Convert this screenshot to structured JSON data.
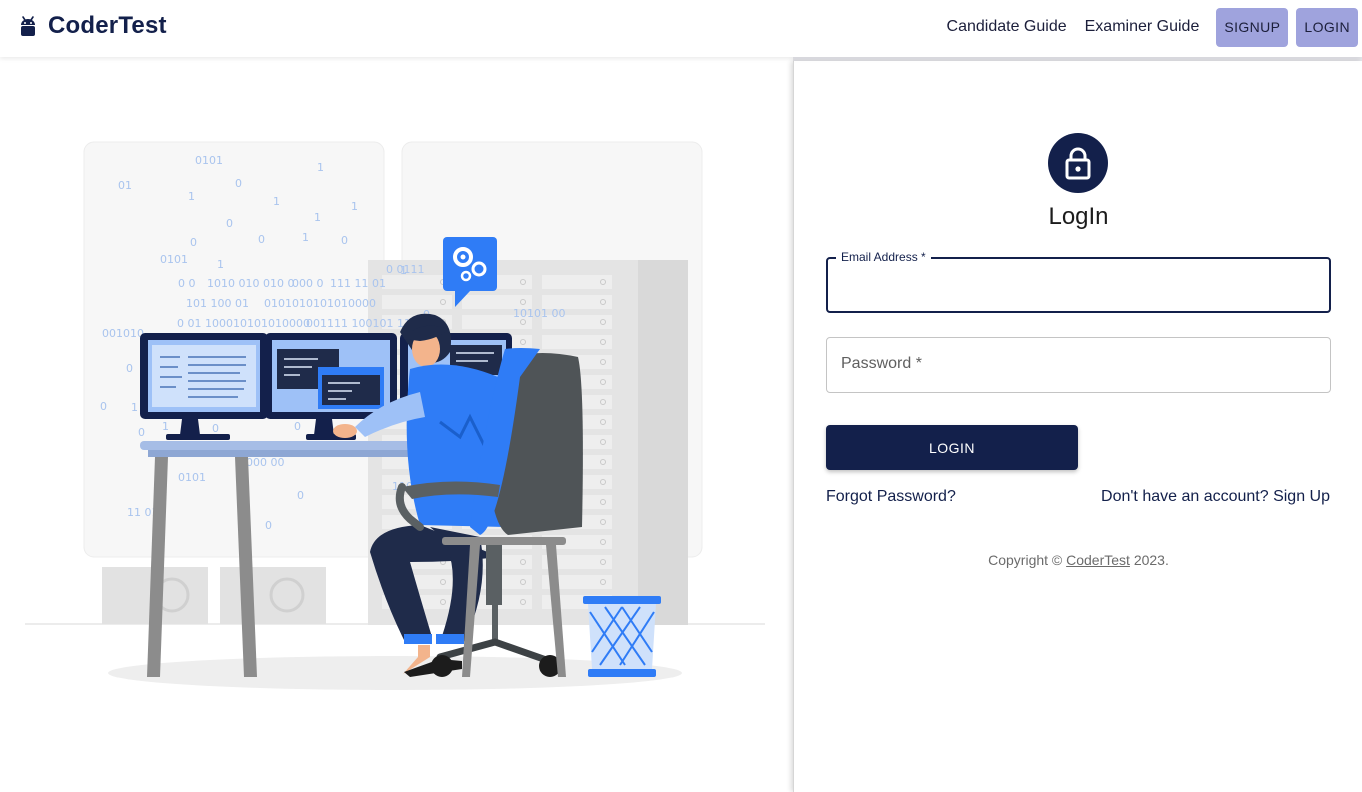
{
  "brand": {
    "name": "CoderTest",
    "icon": "android-icon"
  },
  "nav": {
    "candidate_guide": "Candidate Guide",
    "examiner_guide": "Examiner Guide",
    "signup": "SIGNUP",
    "login": "LOGIN"
  },
  "illustration": {
    "icon": "developer-at-desk-illustration",
    "binary_digits": [
      "0101",
      "1",
      "01",
      "1",
      "0",
      "1",
      "1",
      "0",
      "1",
      "0",
      "0",
      "1",
      "0",
      "0101",
      "1",
      "0 0",
      "1010 010 010 0",
      "000 0",
      "111 11 01",
      "101 100 01",
      "0101010101010000",
      "0 01 100010101010000",
      "001111 100101 110",
      "001010",
      "0",
      "1",
      "0",
      "0",
      "0101",
      "11 01",
      "0",
      "0",
      "1",
      "0",
      "0 0111",
      "1",
      "10101 00",
      "0",
      "000 00",
      "110",
      "0"
    ]
  },
  "form": {
    "lock_icon": "lock-icon",
    "title": "LogIn",
    "email_label": "Email Address *",
    "password_label": "Password *",
    "submit": "LOGIN",
    "forgot": "Forgot Password?",
    "signup_link": "Don't have an account? Sign Up"
  },
  "footer": {
    "copyright_prefix": "Copyright © ",
    "copyright_link": "CoderTest",
    "copyright_suffix": " 2023."
  },
  "colors": {
    "brand_navy": "#13204b",
    "nav_button": "#9fa3dd",
    "accent_blue": "#2f7cf6"
  }
}
